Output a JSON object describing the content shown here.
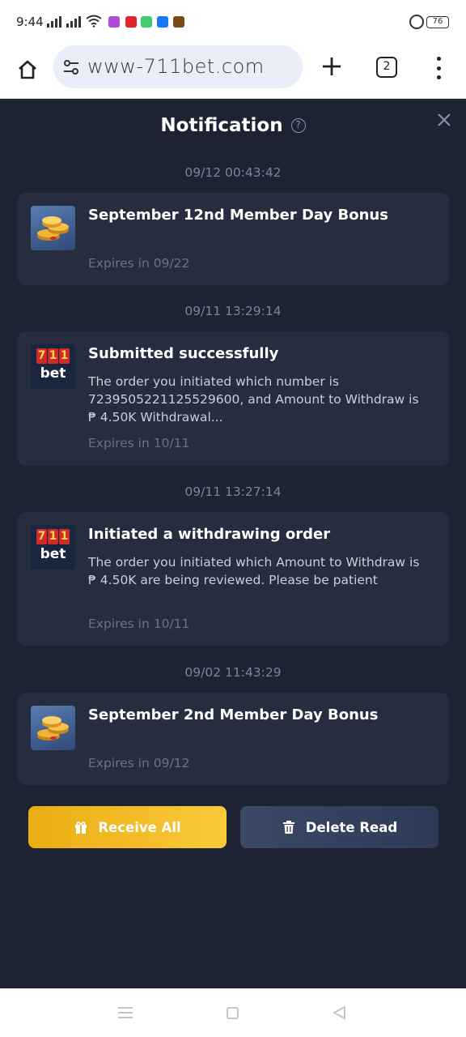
{
  "status_bar": {
    "time": "9:44",
    "battery": "76",
    "app_icon_colors": [
      "#b04bd6",
      "#e0262b",
      "#3fcf6a",
      "#1877f2",
      "#7a4a1a"
    ]
  },
  "browser": {
    "url": "www-711bet.com",
    "tab_count": "2"
  },
  "notification": {
    "title": "Notification",
    "help_glyph": "?",
    "items": [
      {
        "timestamp": "09/12 00:43:42",
        "icon": "coins-icon",
        "title": "September 12nd Member Day Bonus",
        "body": "",
        "expires": "Expires in 09/22"
      },
      {
        "timestamp": "09/11 13:29:14",
        "icon": "711bet-logo-icon",
        "title": "Submitted successfully",
        "body": "The order you initiated which number is 7239505221125529600, and Amount to Withdraw is ₱ 4.50K Withdrawal...",
        "expires": "Expires in 10/11"
      },
      {
        "timestamp": "09/11 13:27:14",
        "icon": "711bet-logo-icon",
        "title": "Initiated a withdrawing order",
        "body": "The order you initiated which Amount to Withdraw is ₱ 4.50K are being reviewed. Please be patient",
        "expires": "Expires in 10/11"
      },
      {
        "timestamp": "09/02 11:43:29",
        "icon": "coins-icon",
        "title": "September 2nd Member Day Bonus",
        "body": "",
        "expires": "Expires in 09/12"
      }
    ],
    "logo": {
      "digits": [
        "7",
        "1",
        "1"
      ],
      "word": "bet"
    },
    "receive_all_label": "Receive All",
    "delete_read_label": "Delete Read"
  },
  "colors": {
    "background": "#1d2333",
    "card": "#262d3f",
    "receive_button": "#f5bb25",
    "delete_button": "#35415e"
  }
}
